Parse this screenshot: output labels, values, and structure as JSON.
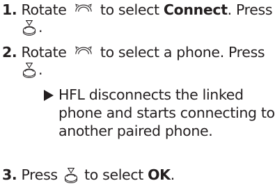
{
  "steps": [
    {
      "number": "1.",
      "line1_before": "Rotate ",
      "line1_after": " to select ",
      "line1_bold": "Connect",
      "line1_end": ". Press",
      "line2_end": "."
    },
    {
      "number": "2.",
      "line1_before": "Rotate ",
      "line1_after": " to select a phone. Press",
      "line2_end": "."
    },
    {
      "number": "3.",
      "before": "Press ",
      "after": " to select ",
      "bold": "OK",
      "end": "."
    }
  ],
  "result": {
    "lines": [
      "HFL disconnects the linked",
      "phone and starts connecting to",
      "another paired phone."
    ]
  },
  "icons": {
    "rotate": "rotate-knob-icon",
    "press": "push-button-icon",
    "result": "result-triangle-icon"
  },
  "colors": {
    "text": "#231f20"
  }
}
